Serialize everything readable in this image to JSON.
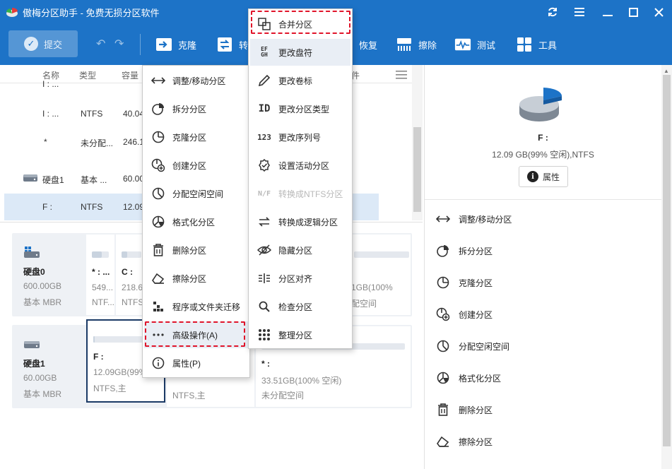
{
  "app": {
    "title": "傲梅分区助手 - 免费无损分区软件"
  },
  "toolbar": {
    "submit_label": "提交",
    "items": [
      {
        "label": "克隆",
        "icon": "clone-arrow-icon"
      },
      {
        "label": "转",
        "icon": "convert-icon"
      },
      {
        "label": "恢复",
        "icon": "recover-icon"
      },
      {
        "label": "擦除",
        "icon": "wipe-icon"
      },
      {
        "label": "测试",
        "icon": "test-icon"
      },
      {
        "label": "工具",
        "icon": "tools-icon"
      }
    ]
  },
  "table": {
    "headers": {
      "name": "名称",
      "type": "类型",
      "capacity": "容量",
      "extra": "件"
    },
    "rows": [
      {
        "name": "I : ...",
        "type": "NTFS",
        "capacity": "40.04"
      },
      {
        "name": "*",
        "type": "未分配...",
        "capacity": "246.1"
      },
      {
        "name": "硬盘1",
        "type": "基本 ...",
        "capacity": "60.00"
      },
      {
        "name": "F :",
        "type": "NTFS",
        "capacity": "12.09"
      }
    ]
  },
  "disks": [
    {
      "name": "硬盘0",
      "size": "600.00GB",
      "type": "基本 MBR",
      "partitions": [
        {
          "name": "* : ...",
          "line1": "549...",
          "line2": "NTF..."
        },
        {
          "name": "C :",
          "line1": "218.6",
          "line2": "NTFS"
        },
        {
          "name": "",
          "line1": "1GB(100%",
          "line2": "配空间"
        }
      ]
    },
    {
      "name": "硬盘1",
      "size": "60.00GB",
      "type": "基本 MBR",
      "partitions": [
        {
          "name": "F :",
          "line1": "12.09GB(99%",
          "line2": "NTFS,主"
        },
        {
          "name": "",
          "line1": "",
          "line2": "NTFS,主"
        },
        {
          "name": "* :",
          "line1": "33.51GB(100% 空闲)",
          "line2": "未分配空间"
        }
      ]
    }
  ],
  "right_panel": {
    "name": "F :",
    "detail": "12.09 GB(99% 空闲),NTFS",
    "properties_label": "属性",
    "actions": [
      "调整/移动分区",
      "拆分分区",
      "克隆分区",
      "创建分区",
      "分配空闲空间",
      "格式化分区",
      "删除分区",
      "擦除分区"
    ]
  },
  "context_menu": {
    "items": [
      "调整/移动分区",
      "拆分分区",
      "克隆分区",
      "创建分区",
      "分配空闲空间",
      "格式化分区",
      "删除分区",
      "擦除分区",
      "程序或文件夹迁移",
      "高级操作(A)",
      "属性(P)"
    ]
  },
  "sub_menu": {
    "items": [
      {
        "label": "合并分区",
        "disabled": false
      },
      {
        "label": "更改盘符",
        "disabled": false
      },
      {
        "label": "更改卷标",
        "disabled": false
      },
      {
        "label": "更改分区类型",
        "disabled": false
      },
      {
        "label": "更改序列号",
        "disabled": false
      },
      {
        "label": "设置活动分区",
        "disabled": false
      },
      {
        "label": "转换成NTFS分区",
        "disabled": true
      },
      {
        "label": "转换成逻辑分区",
        "disabled": false
      },
      {
        "label": "隐藏分区",
        "disabled": false
      },
      {
        "label": "分区对齐",
        "disabled": false
      },
      {
        "label": "检查分区",
        "disabled": false
      },
      {
        "label": "整理分区",
        "disabled": false
      }
    ]
  },
  "colors": {
    "accent": "#1d73c7",
    "highlight": "#e0142a",
    "selected_row": "#dce9f7"
  }
}
